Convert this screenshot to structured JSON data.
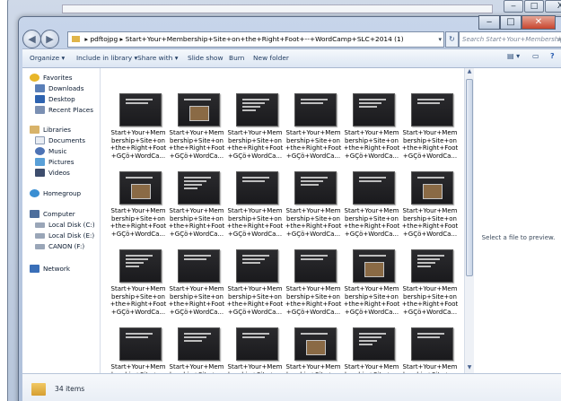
{
  "background_window": {
    "minimize_glyph": "‒",
    "maximize_glyph": "□",
    "close_glyph": "X"
  },
  "window": {
    "minimize_glyph": "‒",
    "maximize_glyph": "□",
    "close_glyph": "✕",
    "accent": "#3a5a8a"
  },
  "nav": {
    "back_glyph": "◀",
    "forward_glyph": "▶",
    "recent_glyph": "▾",
    "refresh_glyph": "↻"
  },
  "address": {
    "chevron": "▸",
    "segments": [
      "pdftojpg",
      "Start+Your+Membership+Site+on+the+Right+Foot+--+WordCamp+SLC+2014 (1)"
    ],
    "dropdown_glyph": "▾"
  },
  "search": {
    "placeholder": "Search Start+Your+Membership+Site...",
    "icon": "search-icon"
  },
  "toolbar": {
    "organize": "Organize ▾",
    "include": "Include in library ▾",
    "share": "Share with ▾",
    "slideshow": "Slide show",
    "burn": "Burn",
    "newfolder": "New folder",
    "views_glyph": "▤ ▾",
    "pane_glyph": "▭",
    "help_glyph": "?"
  },
  "navpane": {
    "favorites": "Favorites",
    "downloads": "Downloads",
    "desktop": "Desktop",
    "recent": "Recent Places",
    "libraries": "Libraries",
    "documents": "Documents",
    "music": "Music",
    "pictures": "Pictures",
    "videos": "Videos",
    "homegroup": "Homegroup",
    "computer": "Computer",
    "disk_c": "Local Disk (C:)",
    "disk_e": "Local Disk (E:)",
    "canon": "CANON (F:)",
    "network": "Network"
  },
  "file_label": "Start+Your+Mem\nbership+Site+on\n+the+Right+Foot\n+GÇö+WordCa...",
  "preview": {
    "message": "Select a file to preview."
  },
  "status": {
    "count": "34 items"
  }
}
